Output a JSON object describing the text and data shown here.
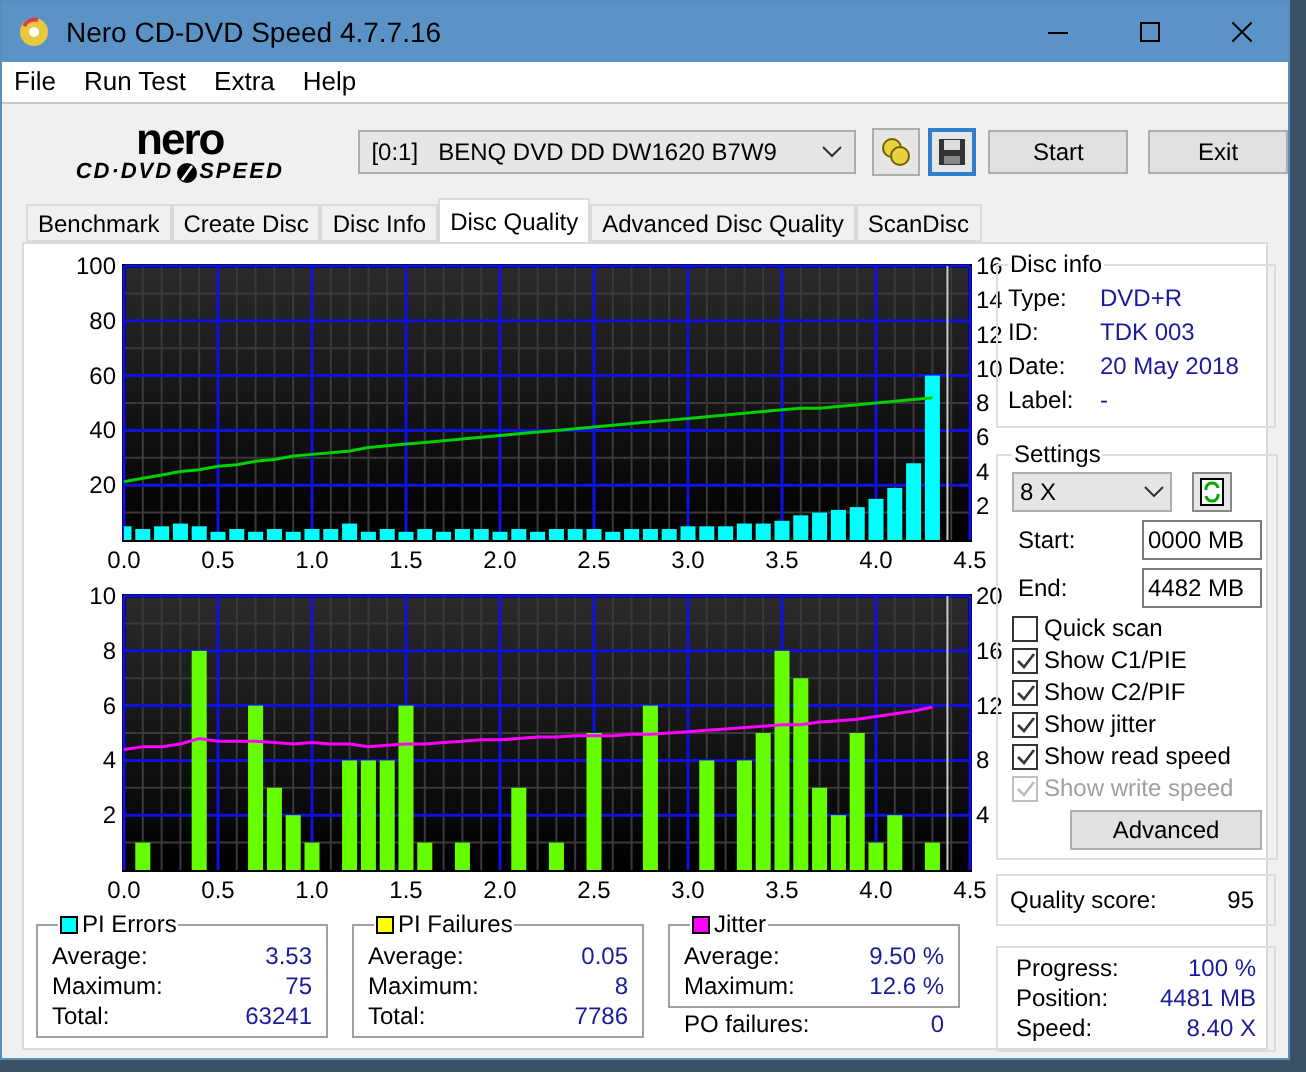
{
  "window": {
    "title": "Nero CD-DVD Speed 4.7.7.16"
  },
  "menu": [
    "File",
    "Run Test",
    "Extra",
    "Help"
  ],
  "toolbar": {
    "logo_top": "nero",
    "logo_left": "CD·DVD",
    "logo_right": "SPEED",
    "drive": "[0:1]   BENQ DVD DD DW1620 B7W9",
    "buttons": [
      "Start",
      "Exit"
    ]
  },
  "tabs": [
    {
      "label": "Benchmark",
      "selected": false
    },
    {
      "label": "Create Disc",
      "selected": false
    },
    {
      "label": "Disc Info",
      "selected": false
    },
    {
      "label": "Disc Quality",
      "selected": true
    },
    {
      "label": "Advanced Disc Quality",
      "selected": false
    },
    {
      "label": "ScanDisc",
      "selected": false
    }
  ],
  "charts": [
    {
      "chart_data": {
        "type": "bar",
        "x": [
          0.0,
          0.1,
          0.2,
          0.3,
          0.4,
          0.5,
          0.6,
          0.7,
          0.8,
          0.9,
          1.0,
          1.1,
          1.2,
          1.3,
          1.4,
          1.5,
          1.6,
          1.7,
          1.8,
          1.9,
          2.0,
          2.1,
          2.2,
          2.3,
          2.4,
          2.5,
          2.6,
          2.7,
          2.8,
          2.9,
          3.0,
          3.1,
          3.2,
          3.3,
          3.4,
          3.5,
          3.6,
          3.7,
          3.8,
          3.9,
          4.0,
          4.1,
          4.2,
          4.3
        ],
        "xlim": [
          0,
          4.5
        ],
        "ylim": [
          0,
          100
        ],
        "y2lim": [
          0,
          16
        ],
        "grid": true,
        "ref_lines": [
          {
            "axis": "x",
            "value": 4.38,
            "color": "#cccccc"
          }
        ],
        "xticks": [
          {
            "value": 0,
            "label": "0.0"
          },
          {
            "value": 0.5,
            "label": "0.5"
          },
          {
            "value": 1,
            "label": "1.0"
          },
          {
            "value": 1.5,
            "label": "1.5"
          },
          {
            "value": 2,
            "label": "2.0"
          },
          {
            "value": 2.5,
            "label": "2.5"
          },
          {
            "value": 3,
            "label": "3.0"
          },
          {
            "value": 3.5,
            "label": "3.5"
          },
          {
            "value": 4,
            "label": "4.0"
          },
          {
            "value": 4.5,
            "label": "4.5"
          }
        ],
        "yticks": [
          20,
          40,
          60,
          80,
          100
        ],
        "y2ticks": [
          2,
          4,
          6,
          8,
          10,
          12,
          14,
          16
        ],
        "series": [
          {
            "color": "#00ffff",
            "values": [
              5,
              4,
              5,
              6,
              5,
              3,
              4,
              3,
              4,
              3,
              4,
              4,
              6,
              3,
              4,
              3,
              4,
              3,
              4,
              4,
              3,
              4,
              3,
              4,
              4,
              4,
              3,
              4,
              4,
              4,
              5,
              5,
              5,
              6,
              6,
              7,
              9,
              10,
              11,
              12,
              15,
              19,
              28,
              60
            ]
          },
          {
            "color": "#00d000",
            "axis": "y2",
            "type": "line",
            "values": [
              3.4,
              3.6,
              3.8,
              4.0,
              4.1,
              4.3,
              4.4,
              4.6,
              4.7,
              4.9,
              5.0,
              5.1,
              5.2,
              5.4,
              5.5,
              5.6,
              5.7,
              5.8,
              5.9,
              6.0,
              6.1,
              6.2,
              6.3,
              6.4,
              6.5,
              6.6,
              6.7,
              6.8,
              6.9,
              7.0,
              7.1,
              7.2,
              7.3,
              7.4,
              7.5,
              7.6,
              7.7,
              7.7,
              7.8,
              7.9,
              8.0,
              8.1,
              8.2,
              8.3
            ]
          }
        ]
      }
    },
    {
      "chart_data": {
        "type": "bar",
        "x": [
          0.0,
          0.1,
          0.2,
          0.3,
          0.4,
          0.5,
          0.6,
          0.7,
          0.8,
          0.9,
          1.0,
          1.1,
          1.2,
          1.3,
          1.4,
          1.5,
          1.6,
          1.7,
          1.8,
          1.9,
          2.0,
          2.1,
          2.2,
          2.3,
          2.4,
          2.5,
          2.6,
          2.7,
          2.8,
          2.9,
          3.0,
          3.1,
          3.2,
          3.3,
          3.4,
          3.5,
          3.6,
          3.7,
          3.8,
          3.9,
          4.0,
          4.1,
          4.2,
          4.3
        ],
        "xlim": [
          0,
          4.5
        ],
        "ylim": [
          0,
          10
        ],
        "y2lim": [
          0,
          20
        ],
        "grid": true,
        "ref_lines": [
          {
            "axis": "x",
            "value": 4.38,
            "color": "#cccccc"
          }
        ],
        "xticks": [
          {
            "value": 0,
            "label": "0.0"
          },
          {
            "value": 0.5,
            "label": "0.5"
          },
          {
            "value": 1,
            "label": "1.0"
          },
          {
            "value": 1.5,
            "label": "1.5"
          },
          {
            "value": 2,
            "label": "2.0"
          },
          {
            "value": 2.5,
            "label": "2.5"
          },
          {
            "value": 3,
            "label": "3.0"
          },
          {
            "value": 3.5,
            "label": "3.5"
          },
          {
            "value": 4,
            "label": "4.0"
          },
          {
            "value": 4.5,
            "label": "4.5"
          }
        ],
        "yticks": [
          2,
          4,
          6,
          8,
          10
        ],
        "y2ticks": [
          4,
          8,
          12,
          16,
          20
        ],
        "series": [
          {
            "color": "#66ff00",
            "values": [
              0,
              1,
              0,
              0,
              8,
              0,
              0,
              6,
              3,
              2,
              1,
              0,
              4,
              4,
              4,
              6,
              1,
              0,
              1,
              0,
              0,
              3,
              0,
              1,
              0,
              5,
              0,
              0,
              6,
              0,
              0,
              4,
              0,
              4,
              5,
              8,
              7,
              3,
              2,
              5,
              1,
              2,
              0,
              1
            ]
          },
          {
            "color": "#ff00ff",
            "axis": "y2",
            "type": "line",
            "values": [
              8.8,
              9.0,
              9.0,
              9.2,
              9.6,
              9.4,
              9.4,
              9.4,
              9.3,
              9.2,
              9.3,
              9.2,
              9.2,
              9.0,
              9.1,
              9.2,
              9.2,
              9.3,
              9.4,
              9.5,
              9.5,
              9.6,
              9.7,
              9.7,
              9.8,
              9.8,
              9.8,
              9.9,
              9.9,
              10.0,
              10.1,
              10.2,
              10.3,
              10.4,
              10.5,
              10.6,
              10.6,
              10.8,
              10.9,
              11.0,
              11.2,
              11.4,
              11.6,
              11.9
            ]
          }
        ]
      }
    }
  ],
  "disc_info": {
    "title": "Disc info",
    "rows": [
      {
        "label": "Type:",
        "value": "DVD+R"
      },
      {
        "label": "ID:",
        "value": "TDK 003"
      },
      {
        "label": "Date:",
        "value": "20 May 2018"
      },
      {
        "label": "Label:",
        "value": "-"
      }
    ]
  },
  "settings": {
    "title": "Settings",
    "speed": "8 X",
    "start_label": "Start:",
    "start": "0000 MB",
    "end_label": "End:",
    "end": "4482 MB",
    "options": [
      {
        "label": "Quick scan",
        "checked": false,
        "disabled": false
      },
      {
        "label": "Show C1/PIE",
        "checked": true,
        "disabled": false
      },
      {
        "label": "Show C2/PIF",
        "checked": true,
        "disabled": false
      },
      {
        "label": "Show jitter",
        "checked": true,
        "disabled": false
      },
      {
        "label": "Show read speed",
        "checked": true,
        "disabled": false
      },
      {
        "label": "Show write speed",
        "checked": true,
        "disabled": true
      }
    ],
    "button": "Advanced"
  },
  "quality": {
    "label": "Quality score:",
    "value": "95"
  },
  "stats": [
    {
      "title": "PI Errors",
      "color": "#00ffff",
      "rows": [
        {
          "label": "Average:",
          "value": "3.53"
        },
        {
          "label": "Maximum:",
          "value": "75"
        },
        {
          "label": "Total:",
          "value": "63241"
        }
      ]
    },
    {
      "title": "PI Failures",
      "color": "#ffff00",
      "rows": [
        {
          "label": "Average:",
          "value": "0.05"
        },
        {
          "label": "Maximum:",
          "value": "8"
        },
        {
          "label": "Total:",
          "value": "7786"
        }
      ]
    },
    {
      "title": "Jitter",
      "color": "#ff00ff",
      "rows": [
        {
          "label": "Average:",
          "value": "9.50 %"
        },
        {
          "label": "Maximum:",
          "value": "12.6 %"
        }
      ]
    }
  ],
  "po_failures": {
    "label": "PO failures:",
    "value": "0"
  },
  "progress": [
    {
      "label": "Progress:",
      "value": "100 %"
    },
    {
      "label": "Position:",
      "value": "4481 MB"
    },
    {
      "label": "Speed:",
      "value": "8.40 X"
    }
  ]
}
